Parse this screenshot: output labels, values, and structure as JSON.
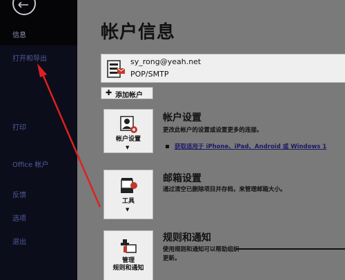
{
  "sidebar": {
    "items": [
      {
        "label": "信息"
      },
      {
        "label": "打开和导出"
      },
      {
        "label": "打印"
      },
      {
        "label": "Office 帐户"
      },
      {
        "label": "反馈"
      },
      {
        "label": "选项"
      },
      {
        "label": "退出"
      }
    ]
  },
  "main": {
    "title": "帐户信息",
    "account": {
      "email": "sy_rong@yeah.net",
      "type": "POP/SMTP"
    },
    "add_account_label": "添加帐户",
    "sections": [
      {
        "tile_label": "帐户设置",
        "title": "帐户设置",
        "desc": "更改此帐户的设置或设置更多的连接。",
        "bullet_text": "获取适用于 iPhone、iPad、Android 或 Windows 1"
      },
      {
        "tile_label": "工具",
        "title": "邮箱设置",
        "desc": "通过清空已删除项目并存档，来管理邮箱大小。"
      },
      {
        "tile_label_line1": "管理",
        "tile_label_line2": "规则和通知",
        "title": "规则和通知",
        "desc_line1": "使用规则和通知可以帮助组织",
        "desc_line2": "更新。"
      }
    ]
  },
  "annotation": {
    "color": "#e02020"
  }
}
